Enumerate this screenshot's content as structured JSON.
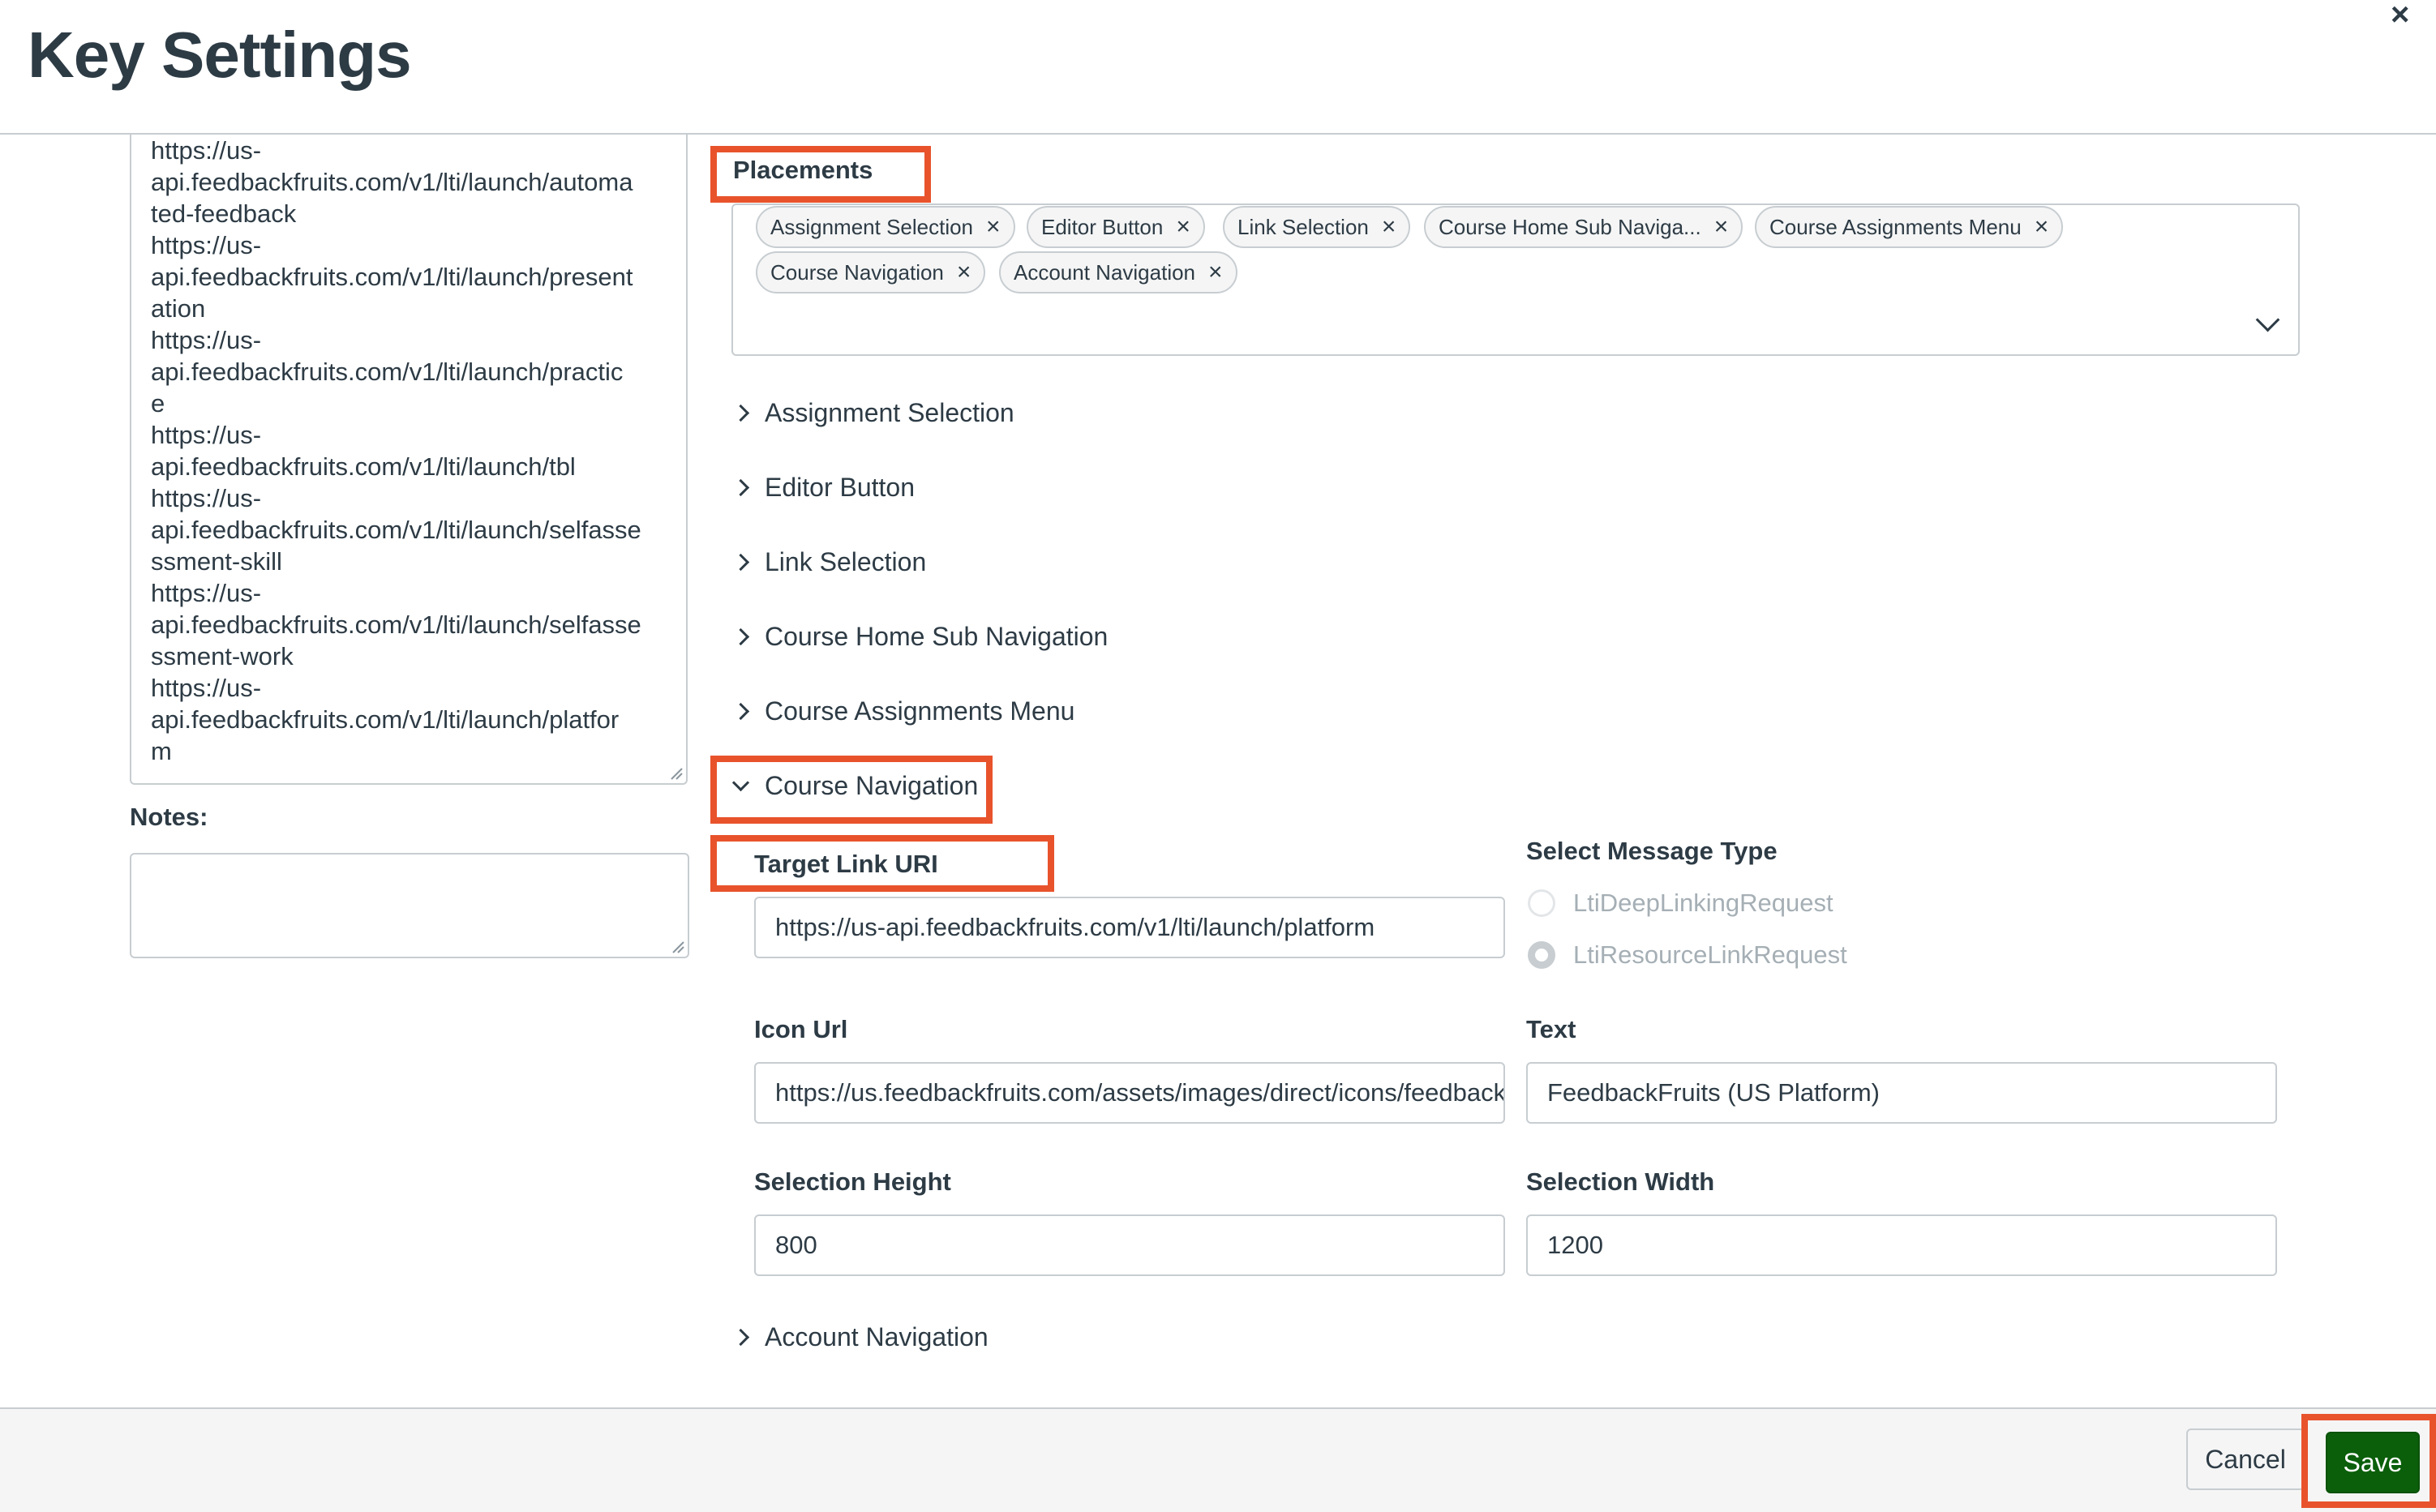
{
  "modal": {
    "title": "Key Settings",
    "close_label": "×"
  },
  "redirect_uris": {
    "lines": [
      "https://us-",
      "api.feedbackfruits.com/v1/lti/launch/automa",
      "ted-feedback",
      "https://us-",
      "api.feedbackfruits.com/v1/lti/launch/present",
      "ation",
      "https://us-",
      "api.feedbackfruits.com/v1/lti/launch/practic",
      "e",
      "https://us-",
      "api.feedbackfruits.com/v1/lti/launch/tbl",
      "https://us-",
      "api.feedbackfruits.com/v1/lti/launch/selfasse",
      "ssment-skill",
      "https://us-",
      "api.feedbackfruits.com/v1/lti/launch/selfasse",
      "ssment-work",
      "https://us-",
      "api.feedbackfruits.com/v1/lti/launch/platfor",
      "m"
    ]
  },
  "notes": {
    "label": "Notes:",
    "value": ""
  },
  "placements": {
    "label": "Placements",
    "chips": [
      "Assignment Selection",
      "Editor Button",
      "Link Selection",
      "Course Home Sub Naviga...",
      "Course Assignments Menu",
      "Course Navigation",
      "Account Navigation"
    ],
    "chip_remove": "×"
  },
  "accordion": {
    "items": [
      "Assignment Selection",
      "Editor Button",
      "Link Selection",
      "Course Home Sub Navigation",
      "Course Assignments Menu",
      "Course Navigation",
      "Account Navigation"
    ]
  },
  "course_navigation": {
    "target_link_uri_label": "Target Link URI",
    "target_link_uri_value": "https://us-api.feedbackfruits.com/v1/lti/launch/platform",
    "message_type_label": "Select Message Type",
    "message_types": [
      "LtiDeepLinkingRequest",
      "LtiResourceLinkRequest"
    ],
    "selected_message_type": "LtiResourceLinkRequest",
    "icon_url_label": "Icon Url",
    "icon_url_value": "https://us.feedbackfruits.com/assets/images/direct/icons/feedbackfruits",
    "text_label": "Text",
    "text_value": "FeedbackFruits (US Platform)",
    "selection_height_label": "Selection Height",
    "selection_height_value": "800",
    "selection_width_label": "Selection Width",
    "selection_width_value": "1200"
  },
  "footer": {
    "cancel_label": "Cancel",
    "save_label": "Save"
  },
  "colors": {
    "highlight": "#e8532c",
    "save_bg": "#0b5f0b",
    "text": "#2d3b45",
    "border": "#c7cdd1"
  }
}
